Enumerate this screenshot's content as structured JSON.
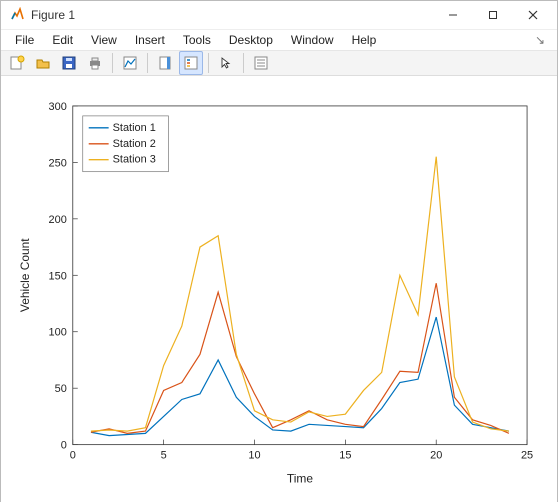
{
  "window": {
    "title": "Figure 1"
  },
  "menubar": {
    "items": [
      "File",
      "Edit",
      "View",
      "Insert",
      "Tools",
      "Desktop",
      "Window",
      "Help"
    ]
  },
  "toolbar": {
    "buttons": [
      {
        "name": "new-figure-icon"
      },
      {
        "name": "open-icon"
      },
      {
        "name": "save-icon"
      },
      {
        "name": "print-icon"
      },
      {
        "sep": true
      },
      {
        "name": "link-plot-icon"
      },
      {
        "sep": true
      },
      {
        "name": "colorbar-icon"
      },
      {
        "name": "legend-icon",
        "selected": true
      },
      {
        "sep": true
      },
      {
        "name": "select-icon"
      },
      {
        "sep": true
      },
      {
        "name": "property-editor-icon"
      }
    ]
  },
  "chart_data": {
    "type": "line",
    "xlabel": "Time",
    "ylabel": "Vehicle Count",
    "xlim": [
      0,
      25
    ],
    "ylim": [
      0,
      300
    ],
    "xticks": [
      0,
      5,
      10,
      15,
      20,
      25
    ],
    "yticks": [
      0,
      50,
      100,
      150,
      200,
      250,
      300
    ],
    "x": [
      1,
      2,
      3,
      4,
      5,
      6,
      7,
      8,
      9,
      10,
      11,
      12,
      13,
      14,
      15,
      16,
      17,
      18,
      19,
      20,
      21,
      22,
      23,
      24
    ],
    "series": [
      {
        "name": "Station 1",
        "color": "#0072bd",
        "values": [
          11,
          8,
          9,
          10,
          25,
          40,
          45,
          75,
          42,
          25,
          13,
          12,
          18,
          17,
          16,
          15,
          32,
          55,
          58,
          113,
          35,
          18,
          15,
          12
        ]
      },
      {
        "name": "Station 2",
        "color": "#d95319",
        "values": [
          11,
          14,
          10,
          12,
          48,
          55,
          80,
          135,
          78,
          45,
          15,
          22,
          30,
          22,
          18,
          16,
          40,
          65,
          64,
          143,
          42,
          22,
          17,
          10
        ]
      },
      {
        "name": "Station 3",
        "color": "#edb120",
        "values": [
          12,
          13,
          12,
          15,
          70,
          105,
          175,
          185,
          80,
          30,
          22,
          20,
          29,
          25,
          27,
          48,
          64,
          150,
          115,
          255,
          60,
          20,
          14,
          12
        ]
      }
    ],
    "legend": {
      "position": "upper-left"
    }
  }
}
